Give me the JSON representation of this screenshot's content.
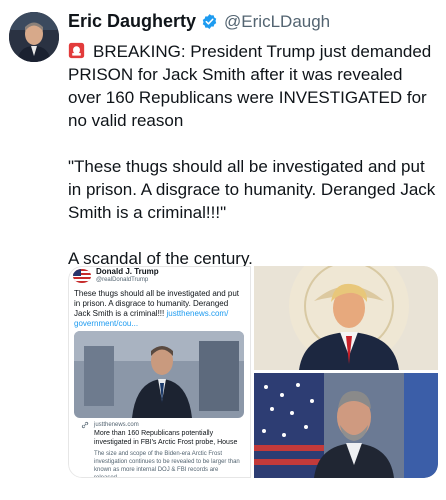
{
  "author": {
    "name": "Eric Daugherty",
    "handle": "@EricLDaugh",
    "verified": true,
    "verified_color": "#1d9bf0"
  },
  "tweet": {
    "siren_icon": "police-light-icon",
    "line1": "BREAKING: President Trump just demanded PRISON for Jack Smith after it was revealed over 160 Republicans were INVESTIGATED for no valid reason",
    "line2": "\"These thugs should all be investigated and put in prison. A disgrace to humanity. Deranged Jack Smith is a criminal!!!\"",
    "line3": "A scandal of the century."
  },
  "embedded_post": {
    "name": "Donald J. Trump",
    "handle": "@realDonaldTrump",
    "text": "These thugs should all be investigated and put in prison. A disgrace to humanity. Deranged Jack Smith is a criminal!!!",
    "link": "justthenews.com/ government/cou...",
    "card_domain": "justthenews.com",
    "card_headline": "More than 160 Republicans potentially investigated in FBI's Arctic Frost probe, House",
    "card_description": "The size and scope of the Biden-era Arctic Frost investigation continues to be revealed to be larger than known as more internal DOJ & FBI records are released."
  },
  "colors": {
    "text": "#0f1419",
    "muted": "#536471",
    "accent": "#1d9bf0"
  }
}
